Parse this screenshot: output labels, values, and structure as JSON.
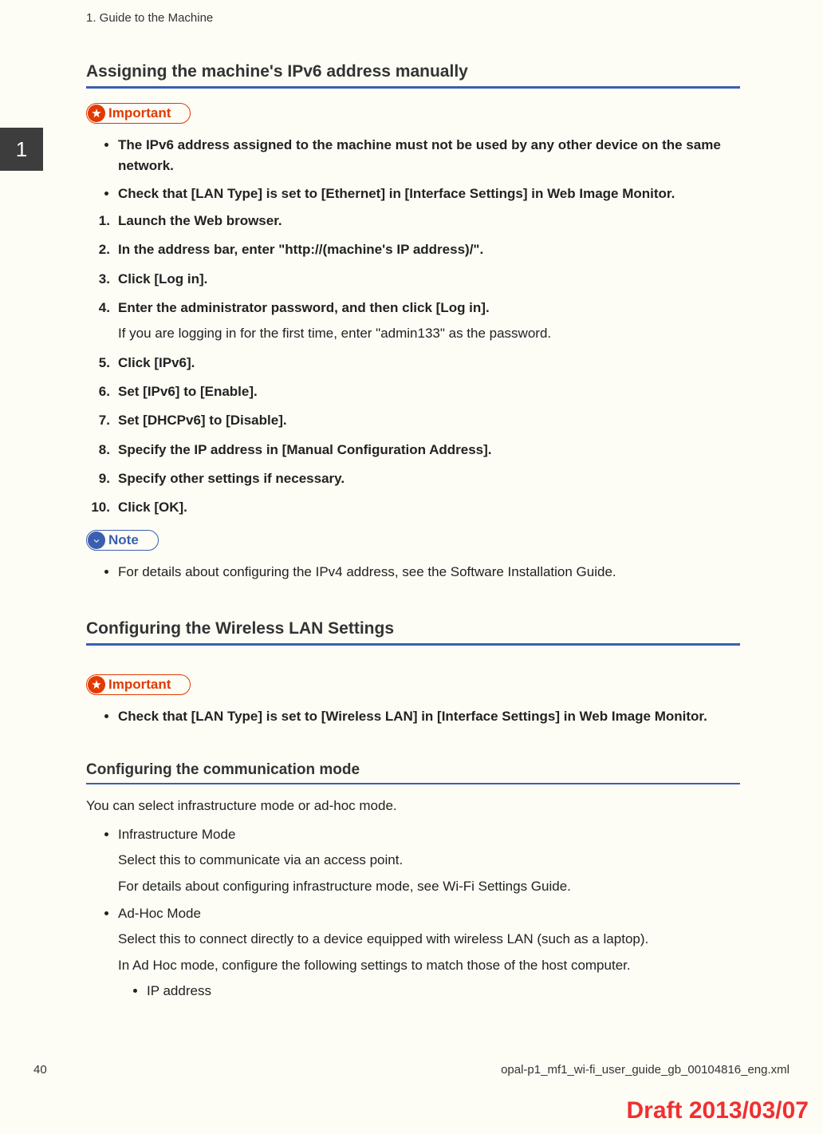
{
  "running_header": "1. Guide to the Machine",
  "chapter_tab": "1",
  "section1": {
    "title": "Assigning the machine's IPv6 address manually",
    "important_label": "Important",
    "important_bullets": [
      "The IPv6 address assigned to the machine must not be used by any other device on the same network.",
      "Check that [LAN Type] is set to [Ethernet] in [Interface Settings] in Web Image Monitor."
    ],
    "steps": [
      {
        "text": "Launch the Web browser."
      },
      {
        "text": "In the address bar, enter \"http://(machine's IP address)/\"."
      },
      {
        "text": "Click [Log in]."
      },
      {
        "text": "Enter the administrator password, and then click [Log in].",
        "sub": "If you are logging in for the first time, enter \"admin133\" as the password."
      },
      {
        "text": "Click [IPv6]."
      },
      {
        "text": "Set [IPv6] to [Enable]."
      },
      {
        "text": "Set [DHCPv6] to [Disable]."
      },
      {
        "text": "Specify the IP address in [Manual Configuration Address]."
      },
      {
        "text": "Specify other settings if necessary."
      },
      {
        "text": "Click [OK]."
      }
    ],
    "note_label": "Note",
    "note_bullets": [
      "For details about configuring the IPv4 address, see the Software Installation Guide."
    ]
  },
  "section2": {
    "title": "Configuring the Wireless LAN Settings",
    "important_label": "Important",
    "important_bullets": [
      "Check that [LAN Type] is set to [Wireless LAN] in [Interface Settings] in Web Image Monitor."
    ]
  },
  "section3": {
    "title": "Configuring the communication mode",
    "intro": "You can select infrastructure mode or ad-hoc mode.",
    "modes": [
      {
        "name": "Infrastructure Mode",
        "desc1": "Select this to communicate via an access point.",
        "desc2": "For details about configuring infrastructure mode, see Wi-Fi Settings Guide."
      },
      {
        "name": "Ad-Hoc Mode",
        "desc1": "Select this to connect directly to a device equipped with wireless LAN (such as a laptop).",
        "desc2": "In Ad Hoc mode, configure the following settings to match those of the host computer.",
        "sub": [
          "IP address"
        ]
      }
    ]
  },
  "footer": {
    "page": "40",
    "file": "opal-p1_mf1_wi-fi_user_guide_gb_00104816_eng.xml"
  },
  "draft": "Draft 2013/03/07"
}
